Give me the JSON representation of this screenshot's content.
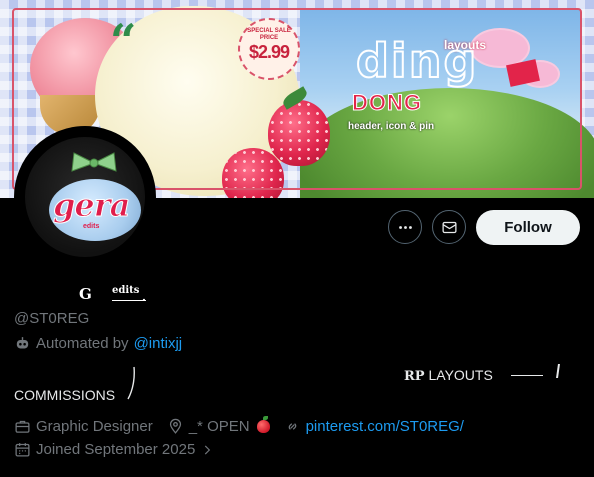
{
  "banner": {
    "price_tag": {
      "line1": "SPECIAL SALE",
      "line2": "PRICE",
      "amount": "$2.99"
    },
    "title_outline": "ding",
    "title_fill": "DONG",
    "layouts_label": "layouts",
    "subtitle": "header, icon & pin"
  },
  "avatar": {
    "logo_text": "gera",
    "sub_text": "edits"
  },
  "actions": {
    "more_icon": "more-horizontal-icon",
    "message_icon": "envelope-icon",
    "follow_label": "Follow"
  },
  "profile": {
    "display_name_g": "G",
    "display_name_edits": "edits",
    "display_name_dot": ".",
    "handle": "@ST0REG",
    "automated_prefix": "Automated by",
    "automated_link": "@intixjj"
  },
  "bio": {
    "commissions": "COMMISSIONS",
    "rp_prefix": "RP",
    "rp_layouts": "LAYOUTS"
  },
  "meta": {
    "category": "Graphic Designer",
    "location": "_* OPEN",
    "website": "pinterest.com/ST0REG/",
    "joined": "Joined September 2025"
  },
  "colors": {
    "background": "#000000",
    "primary_text": "#e7e9ea",
    "secondary_text": "#71767b",
    "link": "#1d9bf0",
    "follow_button_bg": "#eff3f4"
  }
}
